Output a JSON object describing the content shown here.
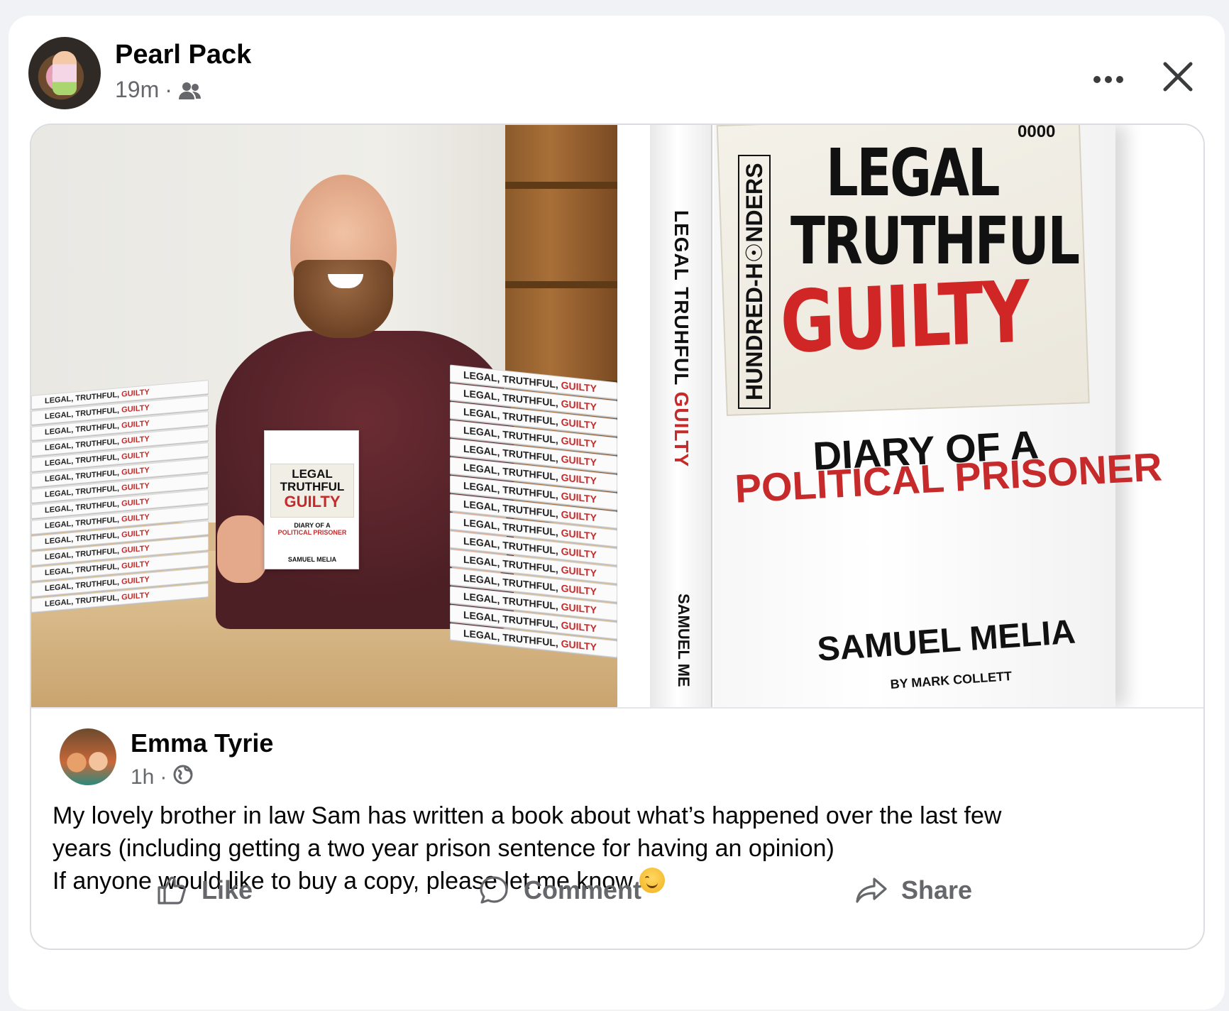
{
  "poster": {
    "name": "Pearl Pack",
    "time": "19m",
    "separator": "·",
    "audience_icon": "friends-icon"
  },
  "header_actions": {
    "more_icon": "more-options-icon",
    "close_icon": "close-icon"
  },
  "shared_post": {
    "author": "Emma Tyrie",
    "time": "1h",
    "separator": "·",
    "audience_icon": "globe-icon",
    "text_lines": [
      "My lovely brother in law Sam has written a book about what’s happened over the last few",
      "years (including getting a two year prison sentence for having an opinion)",
      "If anyone would like to buy a copy, please let me know"
    ],
    "emoji": "smiling-face-emoji"
  },
  "photo_left": {
    "stack_book_title": "LEGAL, TRUTHFUL, ",
    "stack_book_guilty": "GUILTY",
    "stack_spine_author": "SAMUEL MELIA",
    "held_book": {
      "line1": "LEGAL",
      "line2": "TRUTHFUL",
      "line3": "GUILTY",
      "sub1": "DIARY OF A",
      "sub2": "POLITICAL PRISONER",
      "author": "SAMUEL MELIA"
    }
  },
  "photo_right": {
    "spine_title": "LEGAL TRUHFUL ",
    "spine_guilty": "GUILTY",
    "spine_author": "SAMUEL ME",
    "publisher": "HUNDRED-H☉NDERS",
    "code": "0000",
    "title1": "LEGAL",
    "title2": "TRUTHFUL",
    "title3": "GUILTY",
    "subtitle1": "DIARY OF A",
    "subtitle2": "POLITICAL PRISONER",
    "author": "SAMUEL MELIA",
    "foreword": "BY MARK COLLETT"
  },
  "actions": {
    "like": "Like",
    "comment": "Comment",
    "share": "Share"
  },
  "colors": {
    "text_primary": "#050505",
    "text_secondary": "#65676b",
    "cover_red": "#d12626",
    "page_bg": "#f0f2f5"
  }
}
